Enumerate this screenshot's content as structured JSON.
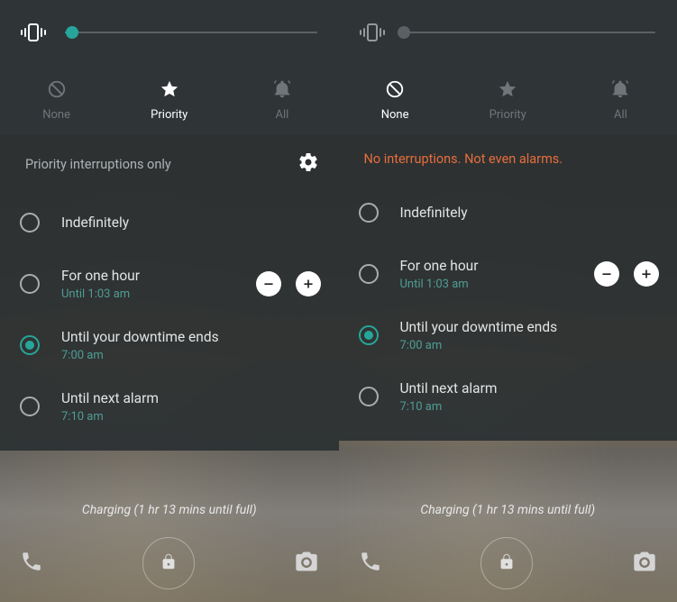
{
  "colors": {
    "accent": "#26a69a",
    "warn": "#e66e3c",
    "panel": "#2f3437"
  },
  "modes": {
    "none": {
      "label": "None"
    },
    "priority": {
      "label": "Priority"
    },
    "all": {
      "label": "All"
    }
  },
  "header": {
    "priority_text": "Priority interruptions only",
    "none_text": "No interruptions. Not even alarms."
  },
  "options": {
    "indefinitely": {
      "title": "Indefinitely"
    },
    "for_hour": {
      "title": "For one hour",
      "sub": "Until 1:03 am"
    },
    "downtime": {
      "title": "Until your downtime ends",
      "sub": "7:00 am"
    },
    "next_alarm": {
      "title": "Until next alarm",
      "sub": "7:10 am"
    }
  },
  "charging_text": "Charging (1 hr 13 mins until full)",
  "left": {
    "active_mode": "priority",
    "selected_option": "downtime",
    "slider_percent": 3,
    "show_gear": true,
    "slider_dim": false
  },
  "right": {
    "active_mode": "none",
    "selected_option": "downtime",
    "slider_percent": 0,
    "show_gear": false,
    "slider_dim": true
  }
}
